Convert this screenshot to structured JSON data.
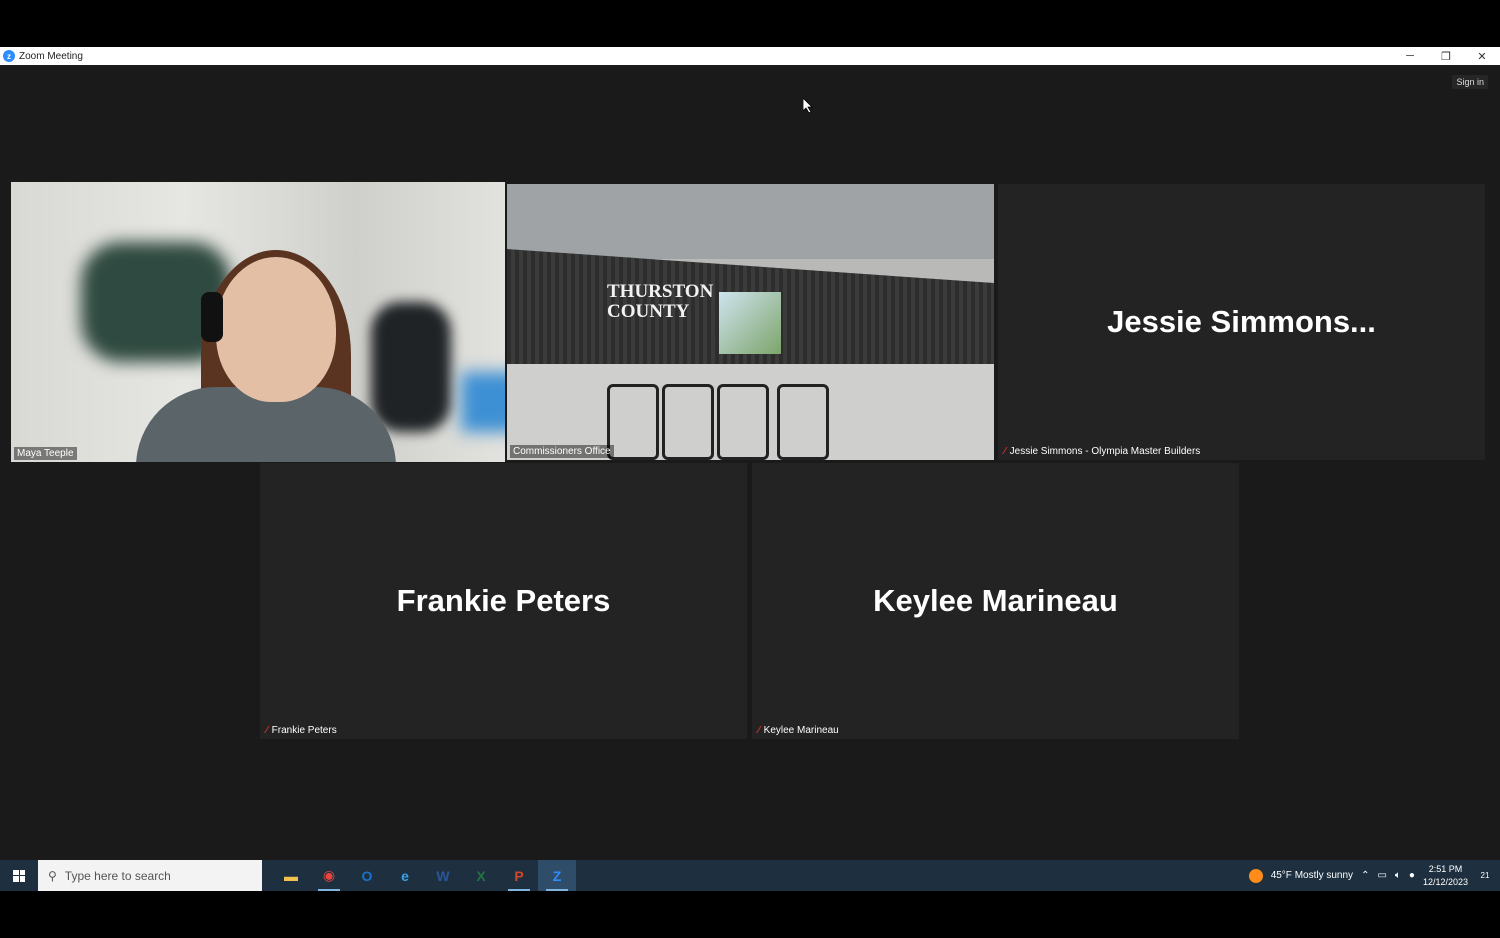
{
  "window": {
    "title": "Zoom Meeting",
    "minimize": "─",
    "restore": "❐",
    "close": "✕"
  },
  "meeting": {
    "sign_in": "Sign in",
    "tiles": [
      {
        "id": "maya",
        "label": "Maya Teeple",
        "display_name": "",
        "muted": false,
        "active_speaker": true
      },
      {
        "id": "commissioners",
        "label": "Commissioners Office",
        "display_name": "",
        "muted": false,
        "active_speaker": false
      },
      {
        "id": "jessie",
        "label": "Jessie Simmons - Olympia Master Builders",
        "display_name": "Jessie  Simmons...",
        "muted": true,
        "active_speaker": false
      },
      {
        "id": "frankie",
        "label": "Frankie Peters",
        "display_name": "Frankie Peters",
        "muted": true,
        "active_speaker": false
      },
      {
        "id": "keylee",
        "label": "Keylee Marineau",
        "display_name": "Keylee Marineau",
        "muted": true,
        "active_speaker": false
      }
    ],
    "room_sign": "THURSTON\nCOUNTY",
    "active_speaker_color": "#c8e06a",
    "muted_color": "#e0312f"
  },
  "taskbar": {
    "search_placeholder": "Type here to search",
    "apps": [
      {
        "name": "file-explorer-icon",
        "glyph": "▬",
        "color": "#f2c14e"
      },
      {
        "name": "chrome-icon",
        "glyph": "◉",
        "color": "#e8453c"
      },
      {
        "name": "outlook-icon",
        "glyph": "O",
        "color": "#1a73c8"
      },
      {
        "name": "edge-icon",
        "glyph": "e",
        "color": "#3aa0e8"
      },
      {
        "name": "word-icon",
        "glyph": "W",
        "color": "#2b579a"
      },
      {
        "name": "excel-icon",
        "glyph": "X",
        "color": "#217346"
      },
      {
        "name": "powerpoint-icon",
        "glyph": "P",
        "color": "#d24726"
      },
      {
        "name": "zoom-icon",
        "glyph": "Z",
        "color": "#2d8cff"
      }
    ],
    "weather": "45°F  Mostly sunny",
    "time": "2:51 PM",
    "date": "12/12/2023",
    "notifications": "21"
  }
}
